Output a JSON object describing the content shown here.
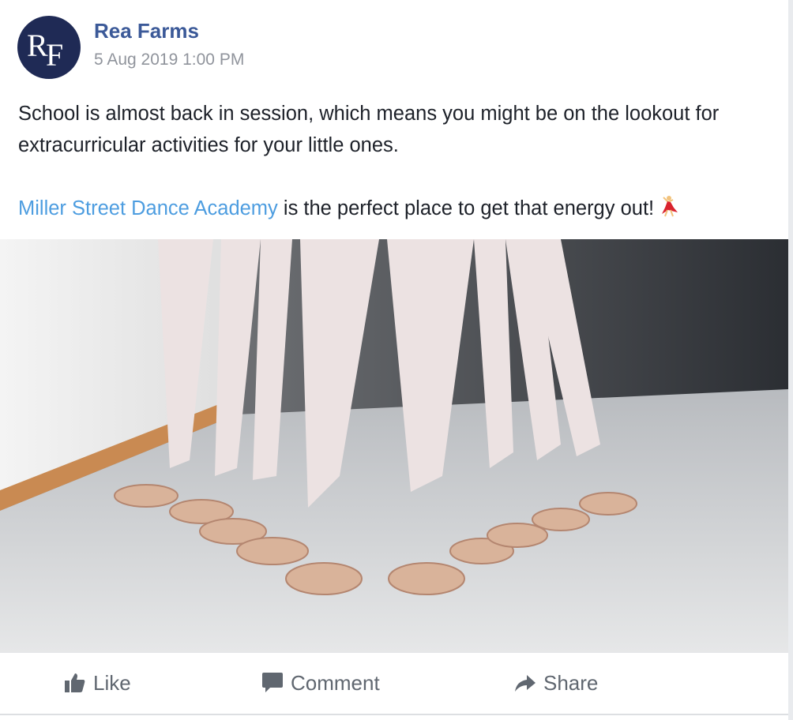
{
  "post": {
    "author": "Rea Farms",
    "avatar_initials": {
      "first": "R",
      "second": "F"
    },
    "timestamp": "5 Aug 2019 1:00 PM",
    "paragraph1": "School is almost back in session, which means you might be on the lookout for extracurricular activities for your little ones.",
    "paragraph2_link": "Miller Street Dance Academy",
    "paragraph2_rest": " is the perfect place to get that energy out!",
    "emoji": "dancer-emoji",
    "photo": "ballet-dancers-feet-photo"
  },
  "actions": {
    "like": "Like",
    "comment": "Comment",
    "share": "Share"
  },
  "colors": {
    "author": "#3b5998",
    "link": "#4d9de0",
    "text": "#1d2129",
    "muted": "#606770",
    "avatar_bg": "#1f2a55"
  }
}
